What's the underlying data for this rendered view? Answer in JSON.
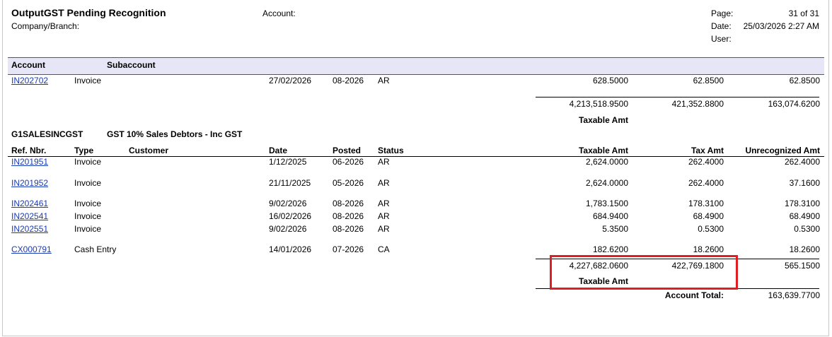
{
  "header": {
    "title": "OutputGST Pending Recognition",
    "company_branch_label": "Company/Branch:",
    "account_label": "Account:",
    "page_label": "Page:",
    "page_value": "31 of 31",
    "date_label": "Date:",
    "date_value": "25/03/2026 2:27 AM",
    "user_label": "User:"
  },
  "group_header": {
    "account": "Account",
    "subaccount": "Subaccount"
  },
  "prev_section": {
    "row": {
      "ref": "IN202702",
      "type": "Invoice",
      "date": "27/02/2026",
      "posted": "08-2026",
      "status": "AR",
      "taxable": "628.5000",
      "tax": "62.8500",
      "unrecognized": "62.8500"
    },
    "totals": {
      "taxable": "4,213,518.9500",
      "tax": "421,352.8800",
      "unrecognized": "163,074.6200"
    },
    "totals_caption": "Taxable Amt"
  },
  "account_section": {
    "account_code": "G1SALESINCGST",
    "account_desc": "GST 10% Sales Debtors - Inc GST",
    "columns": {
      "ref": "Ref. Nbr.",
      "type": "Type",
      "customer": "Customer",
      "date": "Date",
      "posted": "Posted",
      "status": "Status",
      "taxable": "Taxable Amt",
      "tax": "Tax Amt",
      "unrecognized": "Unrecognized Amt"
    },
    "rows": [
      {
        "ref": "IN201951",
        "type": "Invoice",
        "date": "1/12/2025",
        "posted": "06-2026",
        "status": "AR",
        "taxable": "2,624.0000",
        "tax": "262.4000",
        "unrecognized": "262.4000"
      },
      {
        "ref": "IN201952",
        "type": "Invoice",
        "date": "21/11/2025",
        "posted": "05-2026",
        "status": "AR",
        "taxable": "2,624.0000",
        "tax": "262.4000",
        "unrecognized": "37.1600"
      },
      {
        "ref": "IN202461",
        "type": "Invoice",
        "date": "9/02/2026",
        "posted": "08-2026",
        "status": "AR",
        "taxable": "1,783.1500",
        "tax": "178.3100",
        "unrecognized": "178.3100"
      },
      {
        "ref": "IN202541",
        "type": "Invoice",
        "date": "16/02/2026",
        "posted": "08-2026",
        "status": "AR",
        "taxable": "684.9400",
        "tax": "68.4900",
        "unrecognized": "68.4900"
      },
      {
        "ref": "IN202551",
        "type": "Invoice",
        "date": "9/02/2026",
        "posted": "08-2026",
        "status": "AR",
        "taxable": "5.3500",
        "tax": "0.5300",
        "unrecognized": "0.5300"
      },
      {
        "ref": "CX000791",
        "type": "Cash Entry",
        "date": "14/01/2026",
        "posted": "07-2026",
        "status": "CA",
        "taxable": "182.6200",
        "tax": "18.2600",
        "unrecognized": "18.2600"
      }
    ],
    "totals": {
      "taxable": "4,227,682.0600",
      "tax": "422,769.1800",
      "unrecognized": "565.1500"
    },
    "totals_caption": "Taxable Amt",
    "account_total_label": "Account Total:",
    "account_total_value": "163,639.7700"
  },
  "annotation": {
    "highlight_color": "#e01e22"
  }
}
